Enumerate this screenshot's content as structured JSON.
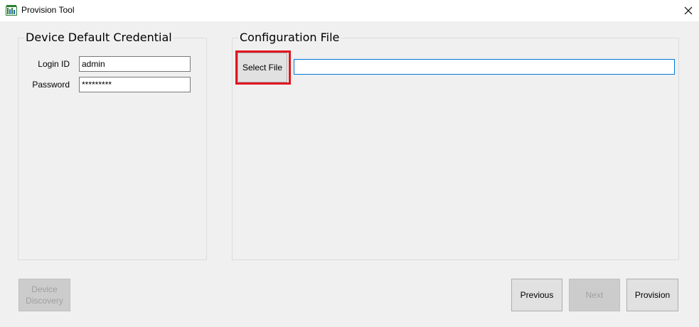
{
  "window": {
    "title": "Provision Tool",
    "app_icon": "provision-tool-icon",
    "close_glyph": "✕"
  },
  "credential": {
    "legend": "Device Default Credential",
    "login_label": "Login ID",
    "login_value": "admin",
    "password_label": "Password",
    "password_value": "*********"
  },
  "config": {
    "legend": "Configuration File",
    "select_label": "Select File",
    "file_path": ""
  },
  "footer": {
    "discovery_label": "Device Discovery",
    "previous_label": "Previous",
    "next_label": "Next",
    "provision_label": "Provision"
  },
  "colors": {
    "highlight": "#e0161f",
    "active_input_border": "#0078d7"
  }
}
